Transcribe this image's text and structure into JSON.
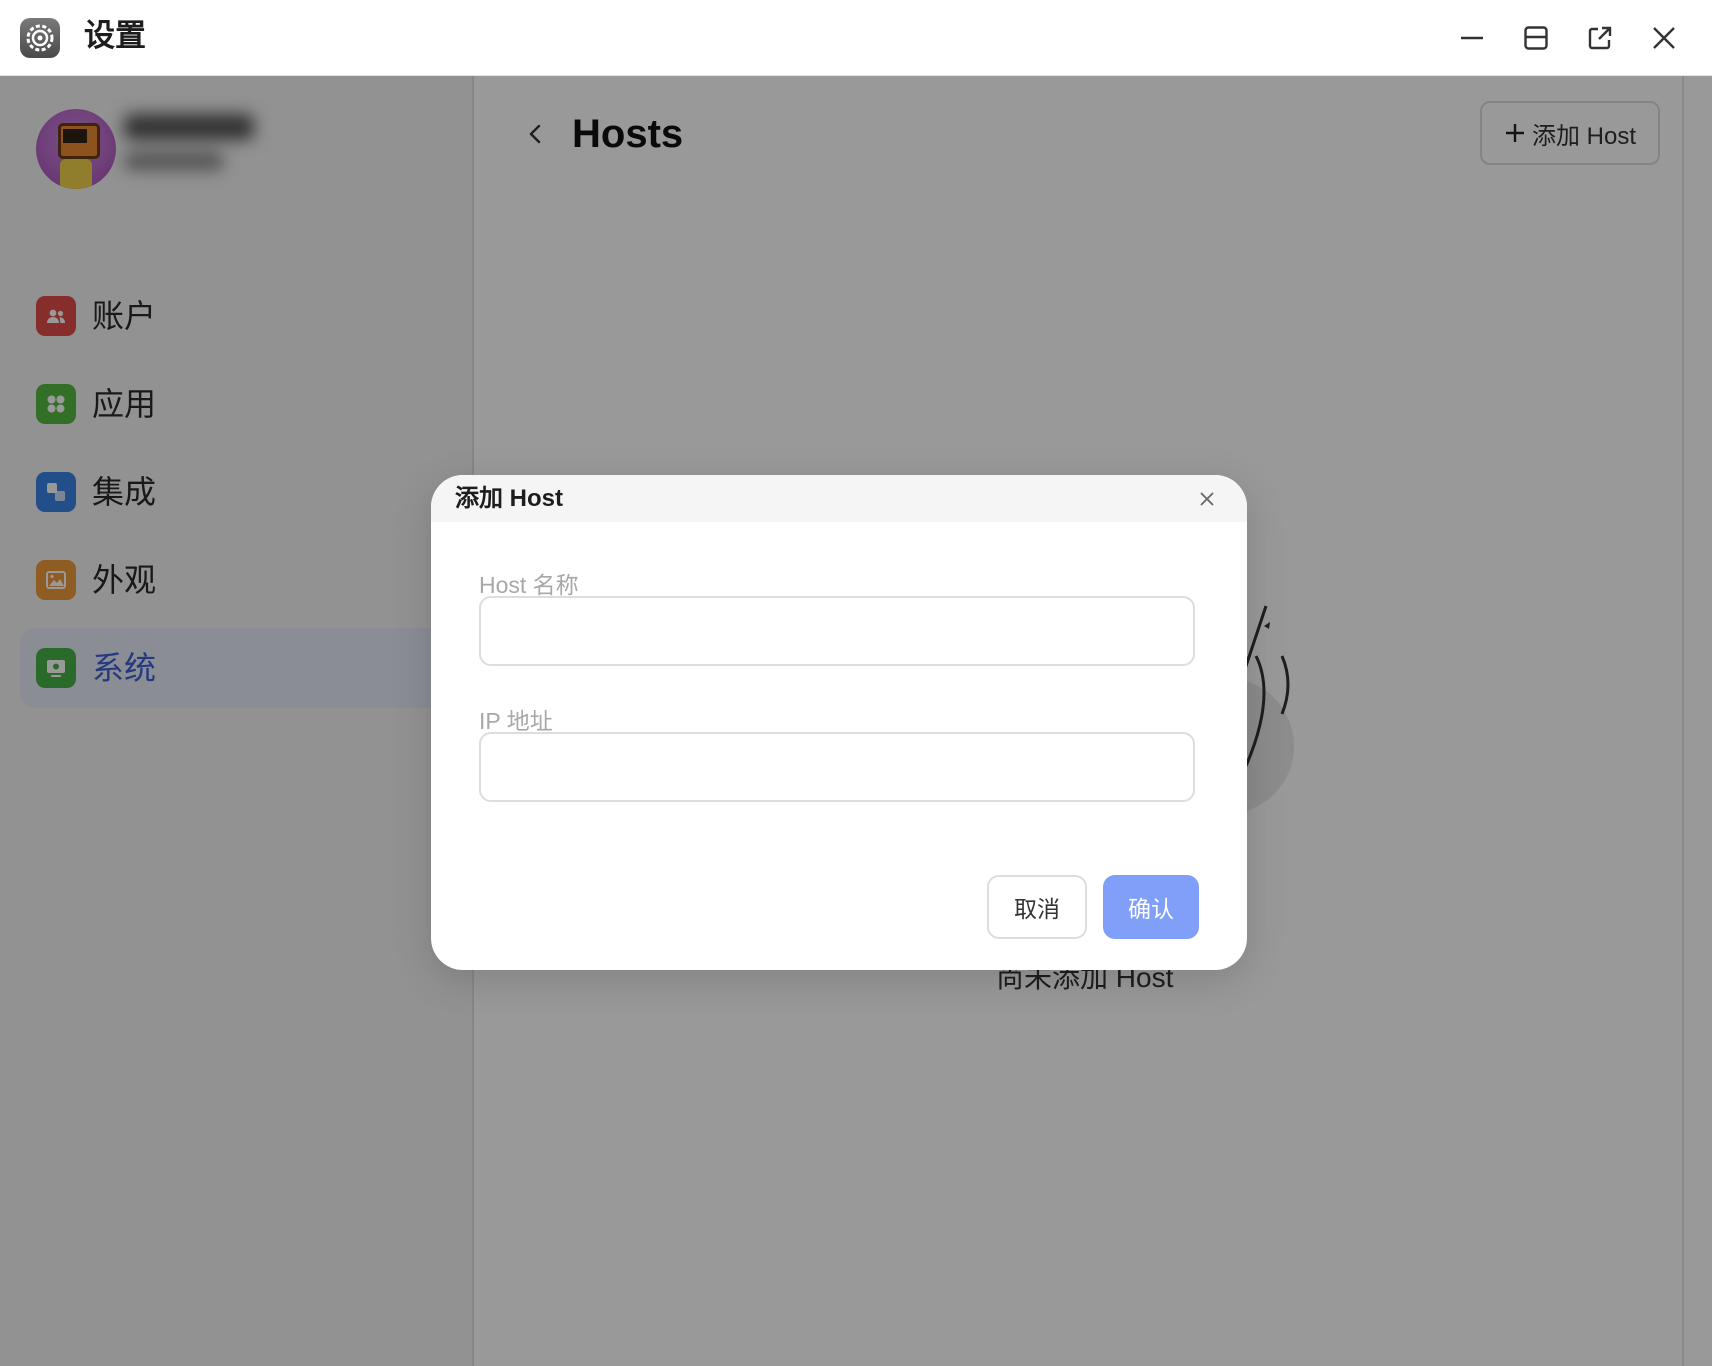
{
  "window": {
    "title": "设置"
  },
  "sidebar": {
    "items": [
      {
        "label": "账户",
        "icon": "users-icon",
        "color": "#e24c48"
      },
      {
        "label": "应用",
        "icon": "apps-icon",
        "color": "#55b940"
      },
      {
        "label": "集成",
        "icon": "integration-icon",
        "color": "#3a82e6"
      },
      {
        "label": "外观",
        "icon": "image-icon",
        "color": "#ef9a3c"
      },
      {
        "label": "系统",
        "icon": "system-icon",
        "color": "#47b34a"
      }
    ],
    "active_index": 4,
    "active_color": "#3d5fd6"
  },
  "main": {
    "title": "Hosts",
    "add_host_label": "添加 Host",
    "empty_text": "尚未添加 Host"
  },
  "modal": {
    "title": "添加 Host",
    "host_name_label": "Host 名称",
    "host_name_value": "",
    "ip_label": "IP 地址",
    "ip_value": "",
    "cancel_label": "取消",
    "confirm_label": "确认",
    "confirm_color": "#7f9ff8"
  }
}
